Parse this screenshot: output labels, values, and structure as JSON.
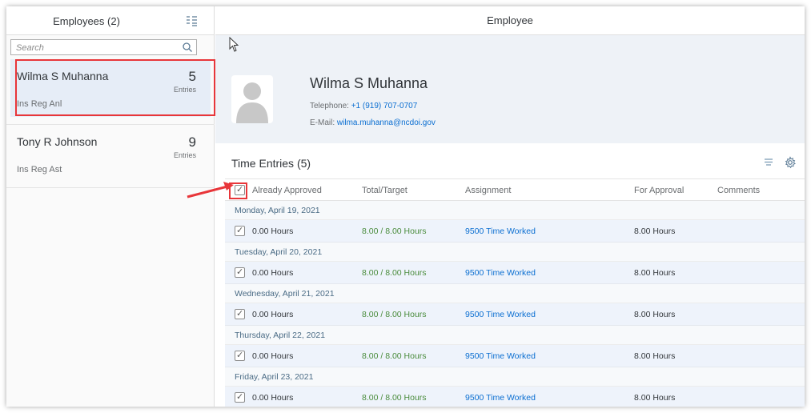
{
  "master": {
    "title": "Employees (2)",
    "search_placeholder": "Search",
    "employees": [
      {
        "name": "Wilma S Muhanna",
        "count": "5",
        "count_label": "Entries",
        "job": "Ins Reg Anl"
      },
      {
        "name": "Tony R Johnson",
        "count": "9",
        "count_label": "Entries",
        "job": "Ins Reg Ast"
      }
    ]
  },
  "detail": {
    "title": "Employee",
    "profile": {
      "name": "Wilma S Muhanna",
      "phone_label": "Telephone:",
      "phone": "+1 (919) 707-0707",
      "email_label": "E-Mail:",
      "email": "wilma.muhanna@ncdoi.gov"
    },
    "entries": {
      "title": "Time Entries (5)",
      "columns": [
        "Already Approved",
        "Total/Target",
        "Assignment",
        "For Approval",
        "Comments"
      ],
      "groups": [
        {
          "date": "Monday, April 19, 2021",
          "approved": "0.00 Hours",
          "total": "8.00 / 8.00 Hours",
          "assignment": "9500 Time Worked",
          "for_approval": "8.00 Hours"
        },
        {
          "date": "Tuesday, April 20, 2021",
          "approved": "0.00 Hours",
          "total": "8.00 / 8.00 Hours",
          "assignment": "9500 Time Worked",
          "for_approval": "8.00 Hours"
        },
        {
          "date": "Wednesday, April 21, 2021",
          "approved": "0.00 Hours",
          "total": "8.00 / 8.00 Hours",
          "assignment": "9500 Time Worked",
          "for_approval": "8.00 Hours"
        },
        {
          "date": "Thursday, April 22, 2021",
          "approved": "0.00 Hours",
          "total": "8.00 / 8.00 Hours",
          "assignment": "9500 Time Worked",
          "for_approval": "8.00 Hours"
        },
        {
          "date": "Friday, April 23, 2021",
          "approved": "0.00 Hours",
          "total": "8.00 / 8.00 Hours",
          "assignment": "9500 Time Worked",
          "for_approval": "8.00 Hours"
        }
      ]
    }
  },
  "colors": {
    "accent": "#0a6ed1",
    "highlight": "#e8363a",
    "positive": "#4a8c3c",
    "selected_bg": "#e6edf7"
  }
}
